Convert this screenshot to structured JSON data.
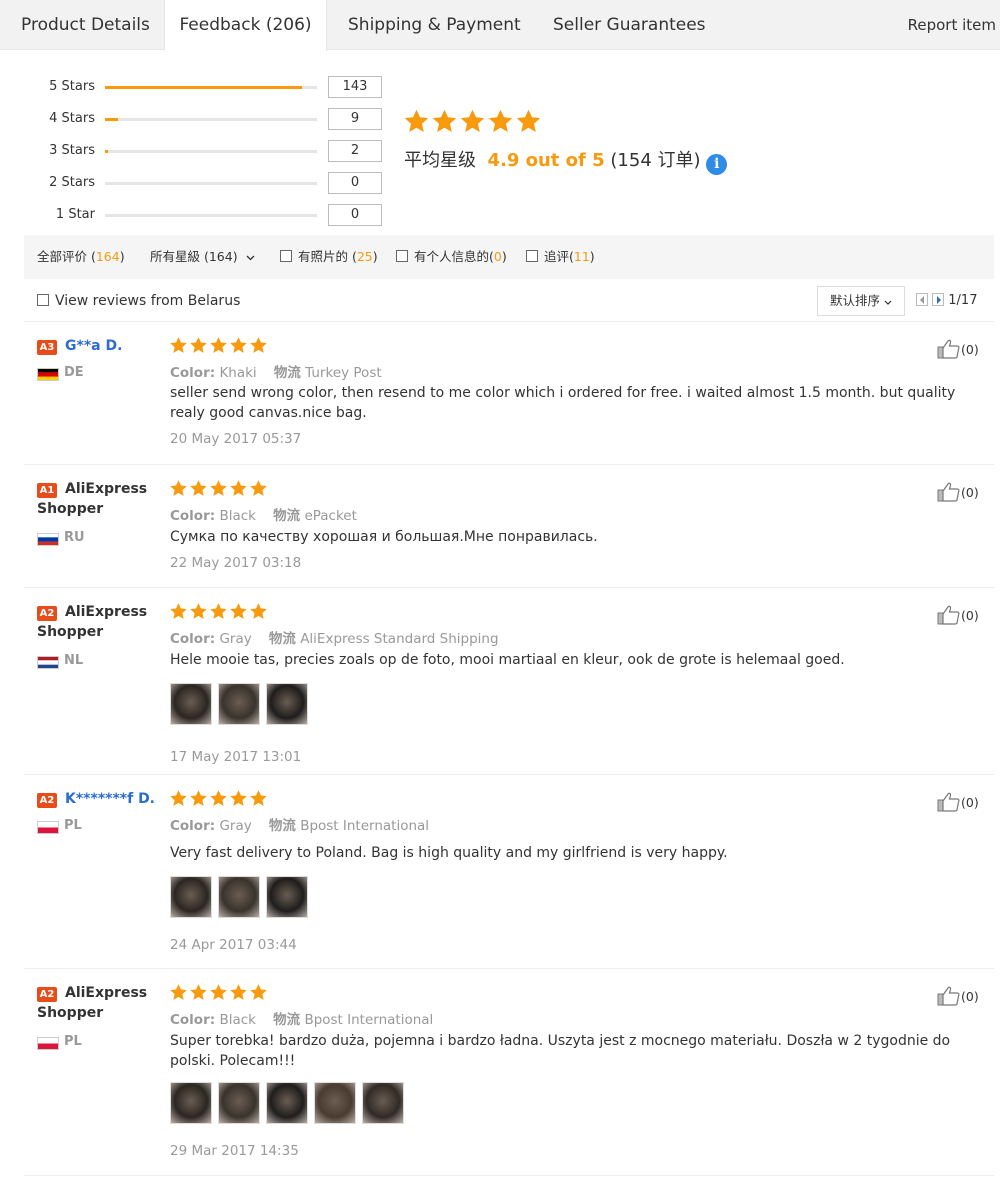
{
  "tabs": [
    {
      "label": "Product Details"
    },
    {
      "label": "Feedback (206)"
    },
    {
      "label": "Shipping & Payment"
    },
    {
      "label": "Seller Guarantees"
    }
  ],
  "report_label": "Report item",
  "histogram": [
    {
      "label": "5 Stars",
      "count": "143",
      "fraction": 0.93
    },
    {
      "label": "4 Stars",
      "count": "9",
      "fraction": 0.06
    },
    {
      "label": "3 Stars",
      "count": "2",
      "fraction": 0.012
    },
    {
      "label": "2 Stars",
      "count": "0",
      "fraction": 0
    },
    {
      "label": "1 Star",
      "count": "0",
      "fraction": 0
    }
  ],
  "average": {
    "prefix": "平均星级",
    "score": "4.9 out of 5",
    "orders": "(154 订单)",
    "info_glyph": "i",
    "stars": 5
  },
  "filters": {
    "all_label": "全部评价 (",
    "all_count": "164",
    "all_close": ")",
    "rating_select": "所有星級 (164)",
    "photos_label": "有照片的 (",
    "photos_count": "25",
    "photos_close": ")",
    "personal_label": "有个人信息的(",
    "personal_count": "0",
    "personal_close": ")",
    "followup_label": "追评(",
    "followup_count": "11",
    "followup_close": ")"
  },
  "view_country_label": "View reviews from Belarus",
  "sort_label": "默认排序",
  "pager": {
    "text": "1/17"
  },
  "colors": {
    "accent": "#f89a0e",
    "badge": "#e84c19",
    "link": "#2b6ccf"
  },
  "reviews": [
    {
      "badge": "A3",
      "name": "G**a D.",
      "name_style": "blue",
      "country": "DE",
      "flag": "de",
      "color_label": "Color:",
      "color_value": "Khaki",
      "ship_label": "物流",
      "ship_value": "Turkey Post",
      "text": "seller send wrong color, then resend to me color which i ordered for free. i waited almost 1.5 month. but quality realy good canvas.nice bag.",
      "date": "20 May 2017 05:37",
      "likes": "(0)",
      "stars": 5,
      "photos": []
    },
    {
      "badge": "A1",
      "name": "AliExpress",
      "name2": "Shopper",
      "name_style": "black",
      "country": "RU",
      "flag": "ru",
      "color_label": "Color:",
      "color_value": "Black",
      "ship_label": "物流",
      "ship_value": "ePacket",
      "text": "Сумка по качеству хорошая и большая.Мне понравилась.",
      "date": "22 May 2017 03:18",
      "likes": "(0)",
      "stars": 5,
      "photos": []
    },
    {
      "badge": "A2",
      "name": "AliExpress",
      "name2": "Shopper",
      "name_style": "black",
      "country": "NL",
      "flag": "nl",
      "color_label": "Color:",
      "color_value": "Gray",
      "ship_label": "物流",
      "ship_value": "AliExpress Standard Shipping",
      "text": "Hele mooie tas, precies zoals op de foto, mooi martiaal en kleur, ook de grote is helemaal goed.",
      "date": "17 May 2017 13:01",
      "likes": "(0)",
      "stars": 5,
      "photos": [
        "bag-photo",
        "bag-photo",
        "bag-photo"
      ]
    },
    {
      "badge": "A2",
      "name": "K*******f D.",
      "name_style": "blue",
      "country": "PL",
      "flag": "pl",
      "color_label": "Color:",
      "color_value": "Gray",
      "ship_label": "物流",
      "ship_value": "Bpost International",
      "text": "Very fast delivery to Poland. Bag is high quality and my girlfriend is very happy.",
      "date": "24 Apr 2017 03:44",
      "likes": "(0)",
      "stars": 5,
      "photos": [
        "bag-photo",
        "bag-photo",
        "bag-photo"
      ]
    },
    {
      "badge": "A2",
      "name": "AliExpress",
      "name2": "Shopper",
      "name_style": "black",
      "country": "PL",
      "flag": "pl",
      "color_label": "Color:",
      "color_value": "Black",
      "ship_label": "物流",
      "ship_value": "Bpost International",
      "text": "Super torebka! bardzo duża, pojemna i bardzo ładna. Uszyta jest z mocnego materiału. Doszła w 2 tygodnie do polski. Polecam!!!",
      "date": "29 Mar 2017 14:35",
      "likes": "(0)",
      "stars": 5,
      "photos": [
        "bag-photo",
        "bag-photo",
        "bag-photo",
        "bag-photo",
        "bag-photo"
      ]
    }
  ]
}
